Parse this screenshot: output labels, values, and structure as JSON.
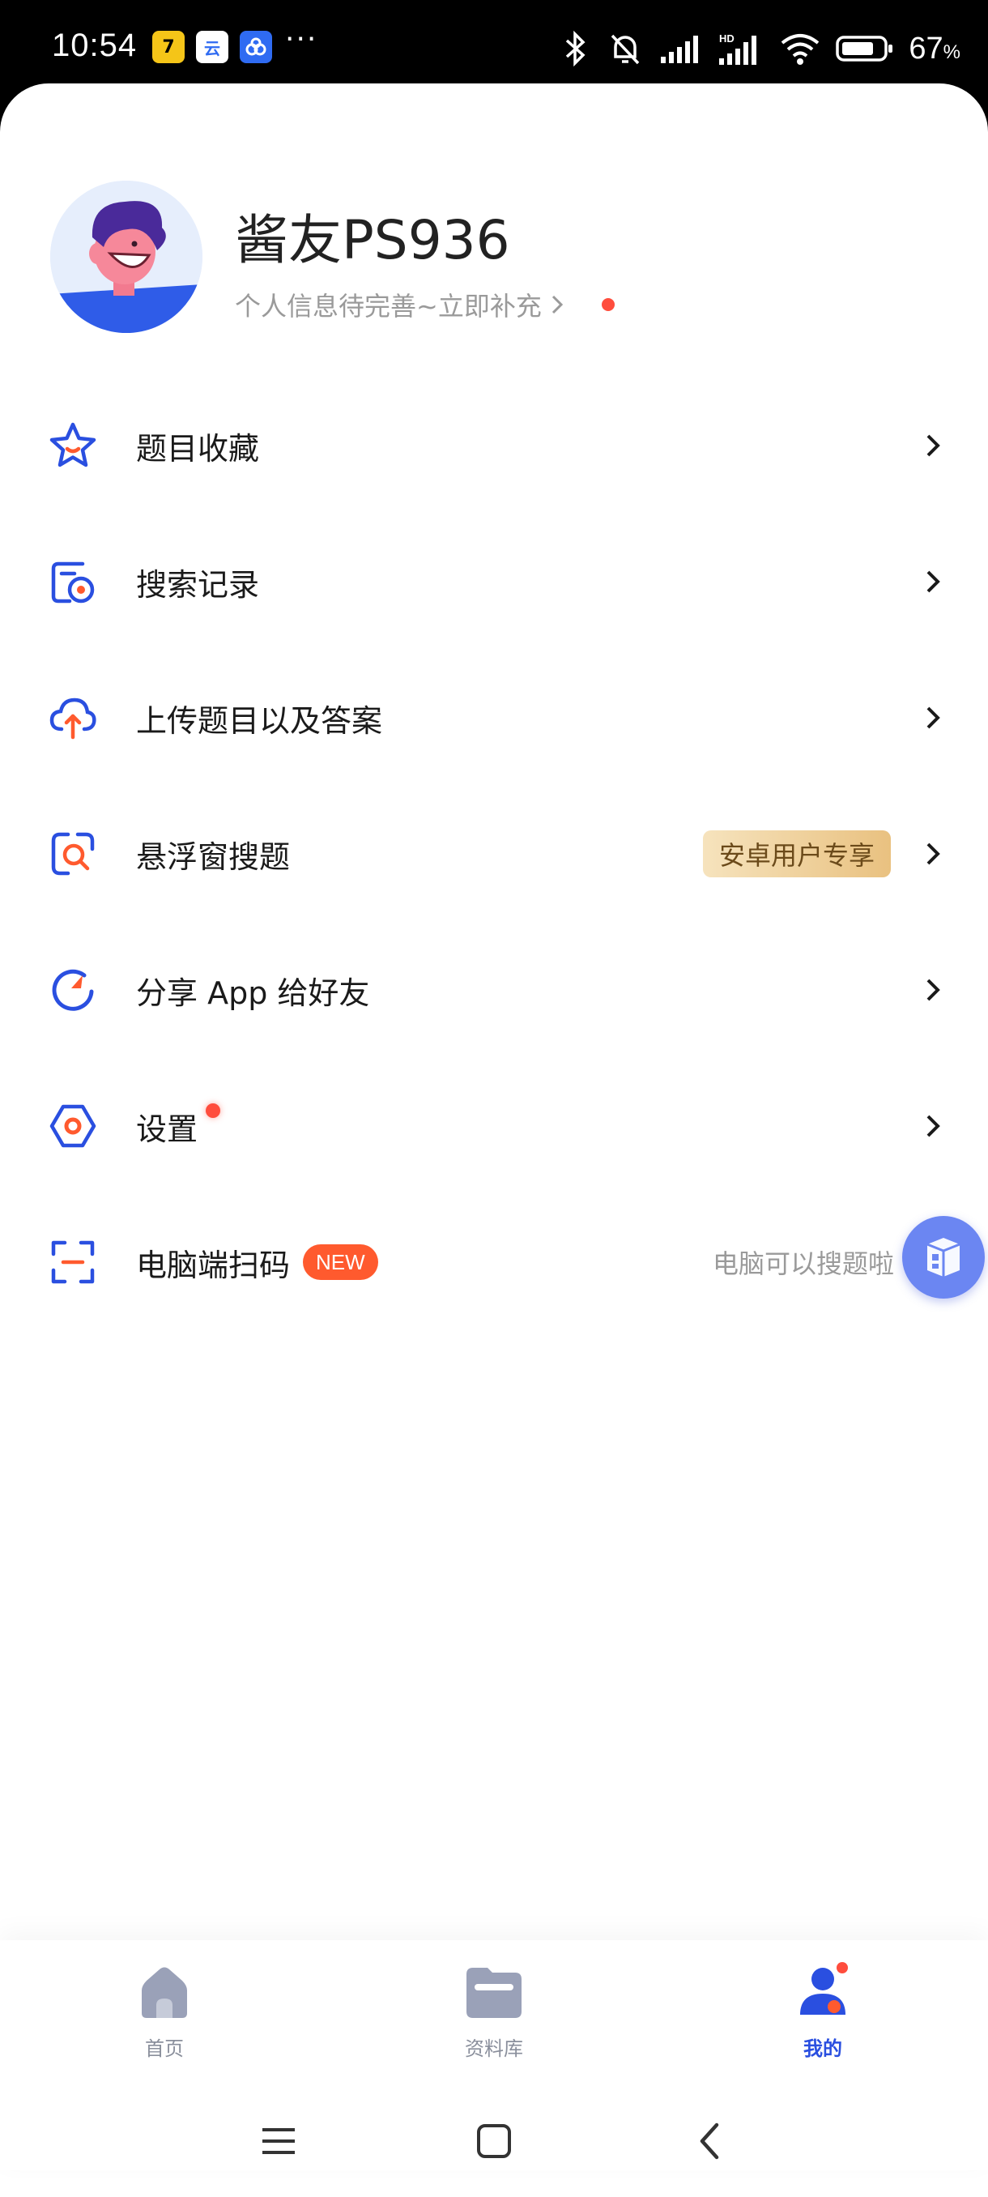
{
  "status_bar": {
    "time": "10:54",
    "app_icons": [
      {
        "name": "app-7-icon",
        "glyph": "7",
        "bg": "#f5c518"
      },
      {
        "name": "app-cloud-icon",
        "glyph": "云",
        "bg": "#ffffff"
      },
      {
        "name": "app-baidu-icon",
        "glyph": "✿",
        "bg": "#2f6bf2"
      }
    ],
    "more": "···",
    "battery_percent": "67",
    "battery_unit": "%"
  },
  "profile": {
    "username": "酱友PS936",
    "hint": "个人信息待完善~立即补充"
  },
  "menu": [
    {
      "key": "favorites",
      "label": "题目收藏"
    },
    {
      "key": "history",
      "label": "搜索记录"
    },
    {
      "key": "upload",
      "label": "上传题目以及答案"
    },
    {
      "key": "float",
      "label": "悬浮窗搜题",
      "badge": "安卓用户专享"
    },
    {
      "key": "share",
      "label": "分享 App 给好友"
    },
    {
      "key": "settings",
      "label": "设置"
    },
    {
      "key": "scan",
      "label": "电脑端扫码",
      "new_badge": "NEW",
      "hint": "电脑可以搜题啦"
    }
  ],
  "tabs": [
    {
      "label": "首页",
      "active": false
    },
    {
      "label": "资料库",
      "active": false
    },
    {
      "label": "我的",
      "active": true
    }
  ],
  "colors": {
    "accent_blue": "#2a4fe0",
    "accent_orange": "#ff5a2e",
    "red_dot": "#ff4d3d"
  }
}
